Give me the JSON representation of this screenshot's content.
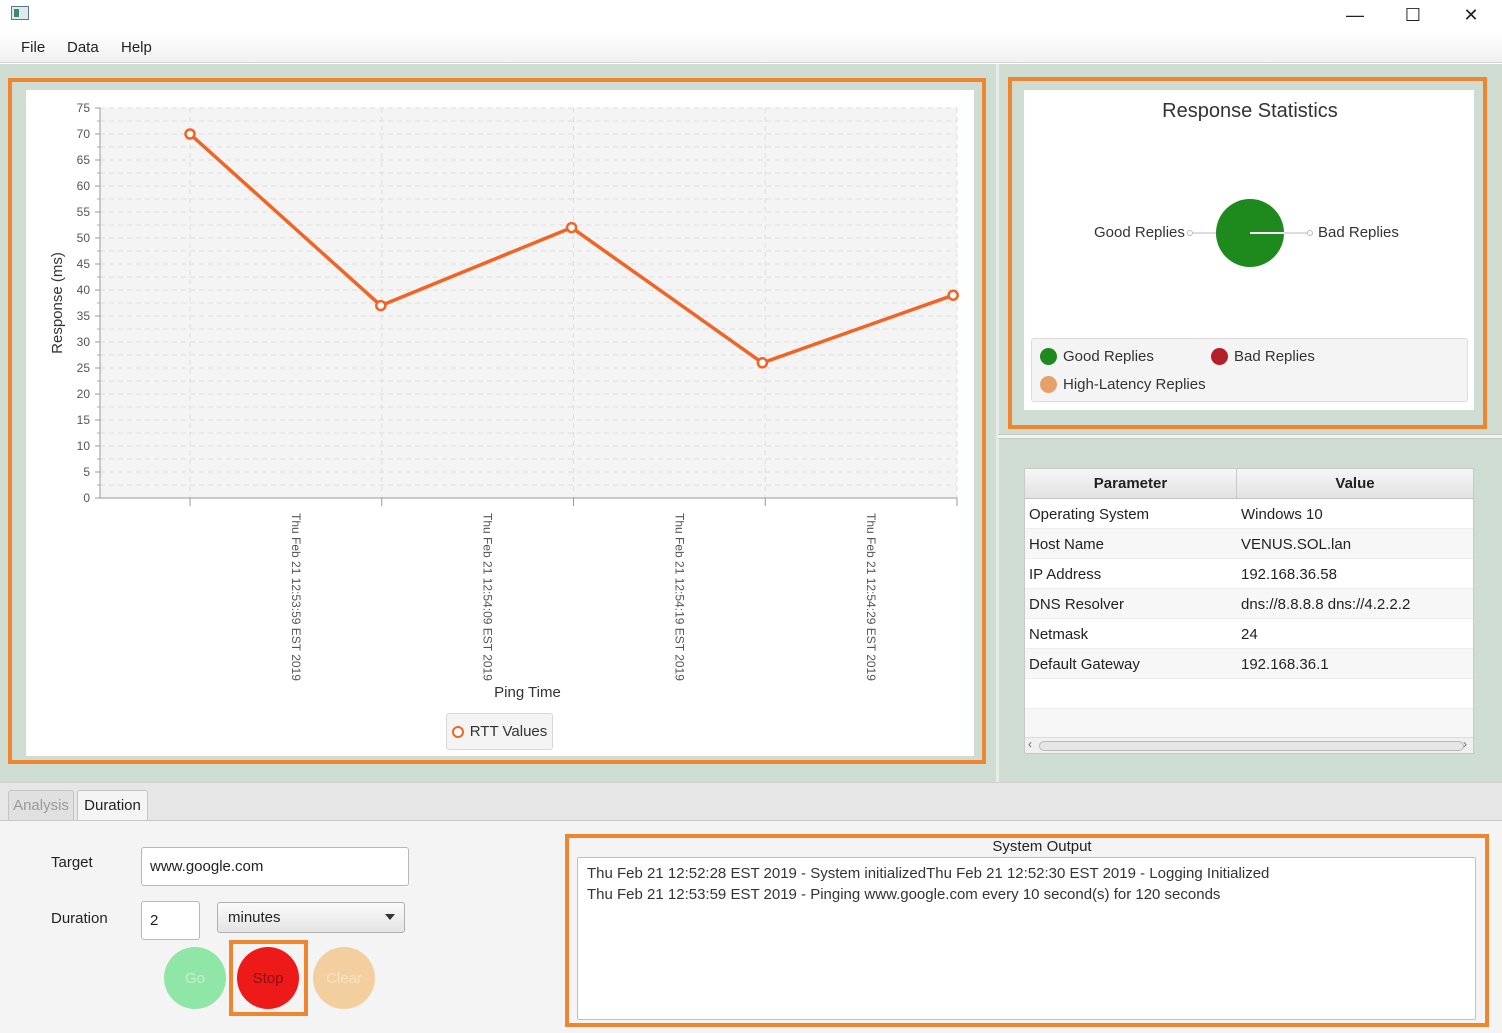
{
  "window": {
    "minimize_glyph": "—",
    "maximize_glyph": "☐",
    "close_glyph": "✕"
  },
  "menu": {
    "file": "File",
    "data": "Data",
    "help": "Help"
  },
  "chart_data": {
    "type": "line",
    "xlabel": "Ping Time",
    "ylabel": "Response (ms)",
    "ylim": [
      0,
      75
    ],
    "y_ticks": [
      0,
      5,
      10,
      15,
      20,
      25,
      30,
      35,
      40,
      45,
      50,
      55,
      60,
      65,
      70,
      75
    ],
    "categories": [
      "Thu Feb 21 12:53:59 EST 2019",
      "Thu Feb 21 12:54:09 EST 2019",
      "Thu Feb 21 12:54:19 EST 2019",
      "Thu Feb 21 12:54:29 EST 2019"
    ],
    "series": [
      {
        "name": "RTT Values",
        "color": "#f06425",
        "values": [
          70,
          37,
          52,
          26,
          39
        ]
      }
    ],
    "grid": true,
    "legend": "bottom-center"
  },
  "stats": {
    "title": "Response Statistics",
    "pie": [
      {
        "label": "Good Replies",
        "value": 100,
        "color": "#1e8a1e"
      },
      {
        "label": "Bad Replies",
        "value": 0,
        "color": "#b3202a"
      }
    ],
    "legend": [
      {
        "label": "Good Replies",
        "color": "#1e8a1e"
      },
      {
        "label": "Bad Replies",
        "color": "#b3202a"
      },
      {
        "label": "High-Latency Replies",
        "color": "#e6a06a"
      }
    ]
  },
  "table": {
    "headers": [
      "Parameter",
      "Value"
    ],
    "rows": [
      [
        "Operating System",
        "Windows 10"
      ],
      [
        "Host Name",
        "VENUS.SOL.lan"
      ],
      [
        "IP Address",
        "192.168.36.58"
      ],
      [
        "DNS Resolver",
        "dns://8.8.8.8 dns://4.2.2.2"
      ],
      [
        "Netmask",
        "24"
      ],
      [
        "Default Gateway",
        "192.168.36.1"
      ]
    ]
  },
  "tabs": {
    "analysis": "Analysis",
    "duration": "Duration"
  },
  "form": {
    "target_label": "Target",
    "target_value": "www.google.com",
    "duration_label": "Duration",
    "duration_value": "2",
    "unit_value": "minutes"
  },
  "buttons": {
    "go": {
      "label": "Go",
      "color": "#90e6a6"
    },
    "stop": {
      "label": "Stop",
      "color": "#ee1a1a"
    },
    "clear": {
      "label": "Clear",
      "color": "#f3cf9f"
    }
  },
  "output": {
    "title": "System Output",
    "lines": [
      "Thu Feb 21 12:52:28 EST 2019 - System initializedThu Feb 21 12:52:30 EST 2019 - Logging Initialized",
      "Thu Feb 21 12:53:59 EST 2019 - Pinging www.google.com every 10 second(s) for 120 seconds"
    ]
  },
  "colors": {
    "accent_border": "#f0852f",
    "panel_bg": "#cfdcd1"
  }
}
